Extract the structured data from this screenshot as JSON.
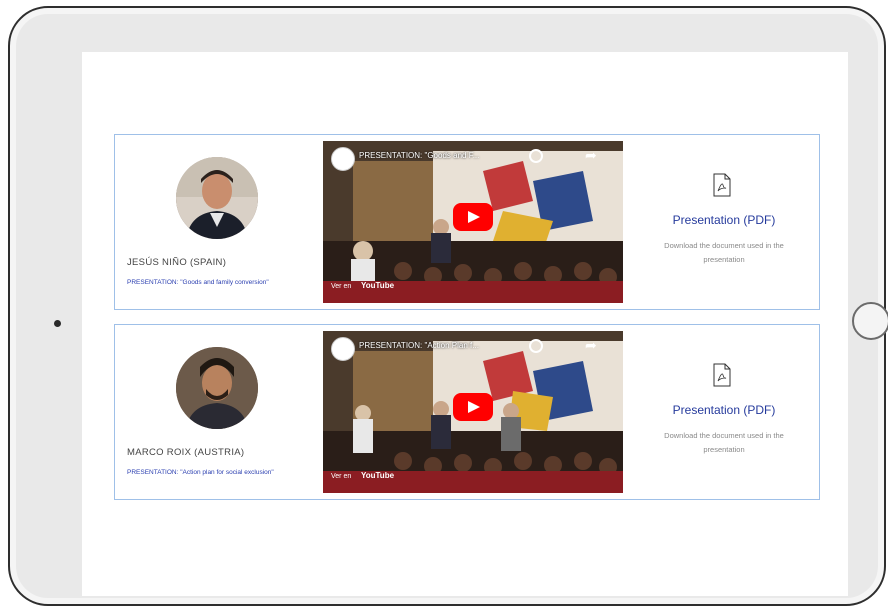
{
  "cards": [
    {
      "speaker_name": "JESÚS NIÑO (SPAIN)",
      "presentation_title": "PRESENTATION: \"Goods and family conversion\"",
      "video_title": "PRESENTATION: \"Goods and F...",
      "pdf_label": "Presentation (PDF)",
      "pdf_description": "Download the document used in the presentation"
    },
    {
      "speaker_name": "MARCO ROIX (AUSTRIA)",
      "presentation_title": "PRESENTATION: \"Action plan for social exclusion\"",
      "video_title": "PRESENTATION: \"Action Plan f...",
      "pdf_label": "Presentation (PDF)",
      "pdf_description": "Download the document used in the presentation"
    }
  ],
  "video": {
    "watch_on": "Ver en",
    "brand": "YouTube"
  },
  "icons": {
    "play": "youtube-play-icon",
    "pdf": "pdf-file-icon",
    "share": "share-icon",
    "clock": "watch-later-icon"
  },
  "colors": {
    "border": "#9fc0e8",
    "link": "#253a9c",
    "youtube_red": "#ff0000"
  }
}
